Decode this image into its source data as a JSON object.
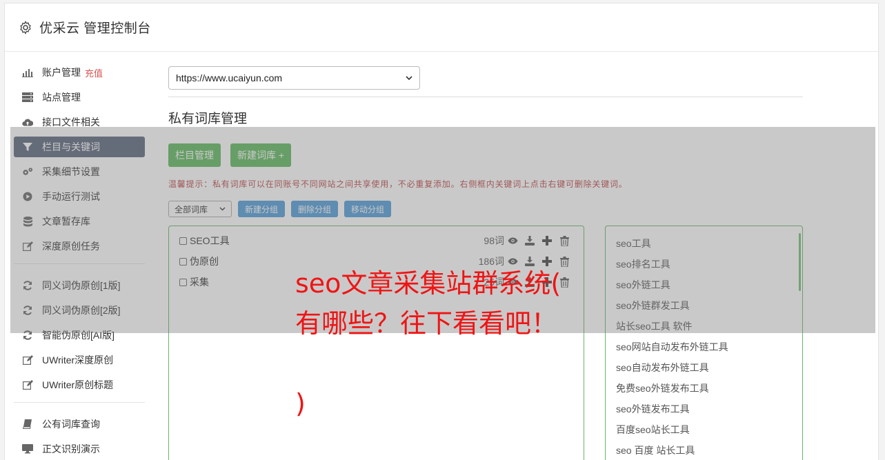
{
  "header": {
    "title": "优采云 管理控制台"
  },
  "sidebar": {
    "group1": [
      {
        "label": "账户管理",
        "icon": "bar-chart-icon",
        "extra": "充值"
      },
      {
        "label": "站点管理",
        "icon": "server-icon"
      },
      {
        "label": "接口文件相关",
        "icon": "cloud-upload-icon"
      },
      {
        "label": "栏目与关键词",
        "icon": "filter-icon",
        "active": true
      },
      {
        "label": "采集细节设置",
        "icon": "gears-icon"
      },
      {
        "label": "手动运行测试",
        "icon": "play-circle-icon"
      },
      {
        "label": "文章暂存库",
        "icon": "database-icon"
      },
      {
        "label": "深度原创任务",
        "icon": "edit-icon"
      }
    ],
    "group2": [
      {
        "label": "同义词伪原创[1版]",
        "icon": "refresh-icon"
      },
      {
        "label": "同义词伪原创[2版]",
        "icon": "refresh-icon"
      },
      {
        "label": "智能伪原创[AI版]",
        "icon": "refresh-icon"
      },
      {
        "label": "UWriter深度原创",
        "icon": "edit-icon"
      },
      {
        "label": "UWriter原创标题",
        "icon": "edit-icon"
      }
    ],
    "group3": [
      {
        "label": "公有词库查询",
        "icon": "book-icon"
      },
      {
        "label": "正文识别演示",
        "icon": "monitor-icon"
      }
    ]
  },
  "main": {
    "site_select_value": "https://www.ucaiyun.com",
    "section_title": "私有词库管理",
    "btn_columns": "栏目管理",
    "btn_new_lib": "新建词库 +",
    "tip": "温馨提示：私有词库可以在同账号不同网站之间共享使用，不必重复添加。右侧框内关键词上点击右键可删除关键词。",
    "filter_select_value": "全部词库",
    "btn_new_group": "新建分组",
    "btn_delete_group": "删除分组",
    "btn_move_group": "移动分组",
    "libraries": [
      {
        "name": "SEO工具",
        "count": "98词"
      },
      {
        "name": "伪原创",
        "count": "186词"
      },
      {
        "name": "采集",
        "count": "25词"
      }
    ],
    "keywords": [
      "seo工具",
      "seo排名工具",
      "seo外链工具",
      "seo外链群发工具",
      "站长seo工具 软件",
      "seo网站自动发布外链工具",
      "seo自动发布外链工具",
      "免费seo外链发布工具",
      "seo外链发布工具",
      "百度seo站长工具",
      "seo 百度 站长工具"
    ]
  },
  "overlay": {
    "line1": "seo文章采集站群系统(",
    "line2": "有哪些？往下看看吧！",
    "line3": ")"
  },
  "colors": {
    "active_nav": "#59647a",
    "green": "#5cb85c",
    "blue": "#4f9ad8",
    "overlay_text": "#f01414"
  }
}
